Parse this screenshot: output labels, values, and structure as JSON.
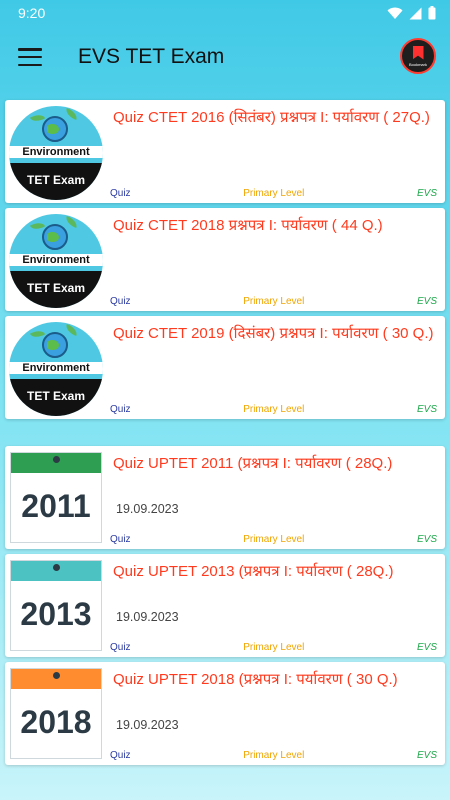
{
  "status_bar": {
    "time": "9:20"
  },
  "app_bar": {
    "title": "EVS TET Exam",
    "bookmark_label": "Bookmark"
  },
  "colors": {
    "accent": "#40c9e6",
    "title_red": "#ff3b1f",
    "quiz_blue": "#2a3aa0",
    "level_orange": "#f0a500",
    "evs_green": "#1ea84b",
    "cal_2011": "#2e9e52",
    "cal_2013": "#4cc3c2",
    "cal_2018": "#ff8c2e"
  },
  "env_cards": [
    {
      "title": "Quiz CTET 2016  (सितंबर)  प्रश्नपत्र I: पर्यावरण ( 27Q.)",
      "thumb_line1": "Environment",
      "thumb_line2": "TET Exam",
      "type": "Quiz",
      "level": "Primary Level",
      "subject": "EVS"
    },
    {
      "title": "Quiz CTET 2018   प्रश्नपत्र I: पर्यावरण ( 44 Q.)",
      "thumb_line1": "Environment",
      "thumb_line2": "TET Exam",
      "type": "Quiz",
      "level": "Primary Level",
      "subject": "EVS"
    },
    {
      "title": "Quiz CTET 2019  (दिसंबर) प्रश्नपत्र I: पर्यावरण ( 30 Q.)",
      "thumb_line1": "Environment",
      "thumb_line2": "TET Exam",
      "type": "Quiz",
      "level": "Primary Level",
      "subject": "EVS"
    }
  ],
  "year_cards": [
    {
      "title": "Quiz UPTET 2011 (प्रश्नपत्र I: पर्यावरण ( 28Q.)",
      "year": "2011",
      "date": "19.09.2023",
      "type": "Quiz",
      "level": "Primary Level",
      "subject": "EVS"
    },
    {
      "title": "Quiz UPTET 2013 (प्रश्नपत्र I: पर्यावरण ( 28Q.)",
      "year": "2013",
      "date": "19.09.2023",
      "type": "Quiz",
      "level": "Primary Level",
      "subject": "EVS"
    },
    {
      "title": "Quiz UPTET 2018 (प्रश्नपत्र I: पर्यावरण ( 30 Q.)",
      "year": "2018",
      "date": "19.09.2023",
      "type": "Quiz",
      "level": "Primary Level",
      "subject": "EVS"
    }
  ]
}
